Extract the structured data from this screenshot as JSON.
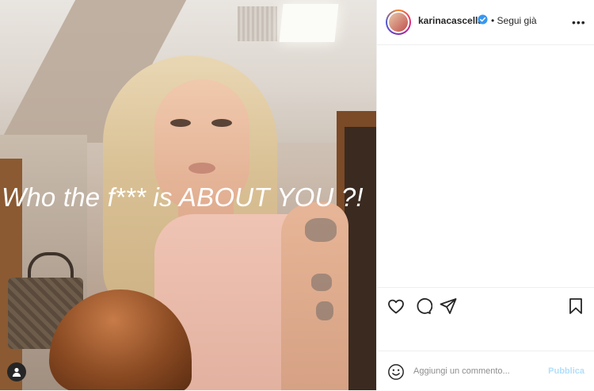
{
  "post": {
    "overlay_text": "Who the f*** is ABOUT YOU ?!",
    "author": {
      "username": "karinacascella",
      "verified": true,
      "follow_status": "• Segui già"
    },
    "more_icon": "more-horizontal-icon"
  },
  "actions": {
    "like_icon": "heart-icon",
    "comment_icon": "comment-icon",
    "share_icon": "share-icon",
    "save_icon": "bookmark-icon"
  },
  "comment_box": {
    "placeholder": "Aggiungi un commento...",
    "publish_label": "Pubblica",
    "emoji_icon": "emoji-icon"
  },
  "colors": {
    "verified_blue": "#3897f0",
    "publish_disabled": "#b2dffc",
    "text": "#262626",
    "border": "#efefef"
  }
}
